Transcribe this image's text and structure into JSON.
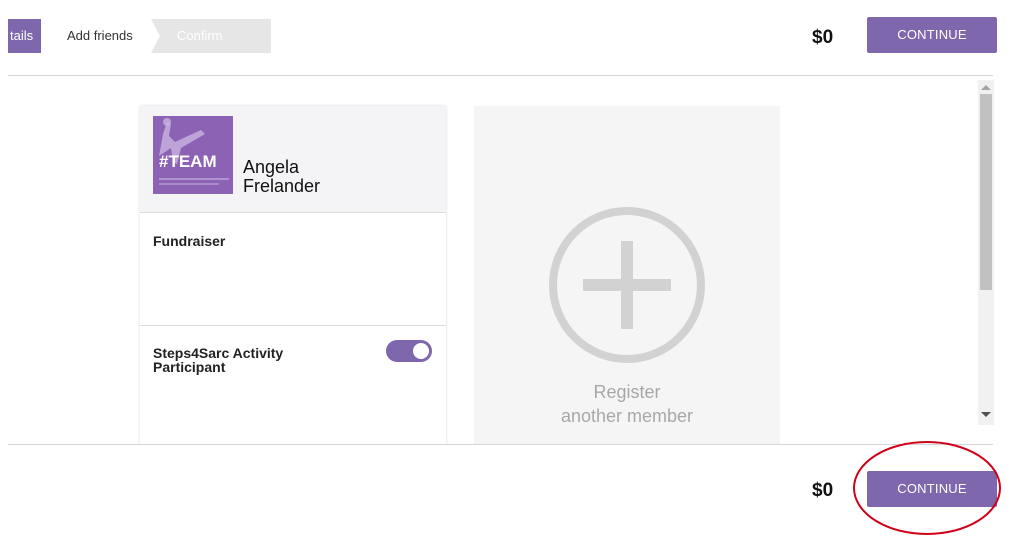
{
  "steps": [
    {
      "label": "tails",
      "state": "completed"
    },
    {
      "label": "Add friends",
      "state": "current"
    },
    {
      "label": "Confirm",
      "state": "upcoming"
    }
  ],
  "header": {
    "total": "$0",
    "continue_label": "CONTINUE"
  },
  "member_card": {
    "avatar_text": "#TEAM",
    "name_line1": "Angela",
    "name_line2": "Frelander",
    "sections": [
      {
        "title": "Fundraiser"
      },
      {
        "title_line1": "Steps4Sarc Activity",
        "title_line2": "Participant",
        "toggle_on": true
      }
    ]
  },
  "add_member": {
    "line1": "Register",
    "line2": "another member",
    "icon": "plus-circle-icon"
  },
  "footer": {
    "total": "$0",
    "continue_label": "CONTINUE"
  },
  "colors": {
    "accent": "#7e67ad",
    "annotation": "#d0021b"
  }
}
